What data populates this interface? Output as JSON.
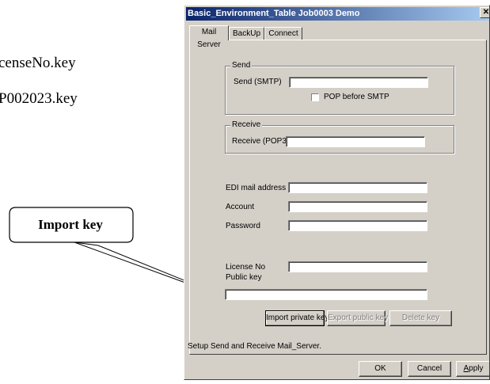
{
  "background_doc": {
    "line1": "censeNo.key",
    "line2": "P002023.key"
  },
  "callout": {
    "label": "Import key"
  },
  "window": {
    "title": "Basic_Environment_Table Job0003 Demo",
    "close_glyph": "✕",
    "tabs": [
      {
        "label": "Mail Server",
        "active": true
      },
      {
        "label": "BackUp",
        "active": false
      },
      {
        "label": "Connect",
        "active": false
      }
    ],
    "send": {
      "group_label": "Send",
      "smtp_label": "Send (SMTP)",
      "smtp_value": "",
      "pop_before_smtp_label": "POP before SMTP",
      "pop_before_smtp_checked": false
    },
    "receive": {
      "group_label": "Receive",
      "pop3_label": "Receive (POP3)",
      "pop3_value": ""
    },
    "account_fields": {
      "edi_mail_label": "EDI mail address",
      "edi_mail_value": "",
      "account_label": "Account",
      "account_value": "",
      "password_label": "Password",
      "password_value": ""
    },
    "license": {
      "license_no_label": "License No",
      "license_no_value": "",
      "public_key_label": "Public key",
      "public_key_value": ""
    },
    "key_buttons": {
      "import_private": "Import private key",
      "export_public": "Export public key",
      "delete": "Delete key"
    },
    "status_text": "Setup Send and Receive Mail_Server.",
    "footer_buttons": {
      "ok": "OK",
      "cancel": "Cancel",
      "apply": "Apply"
    }
  }
}
